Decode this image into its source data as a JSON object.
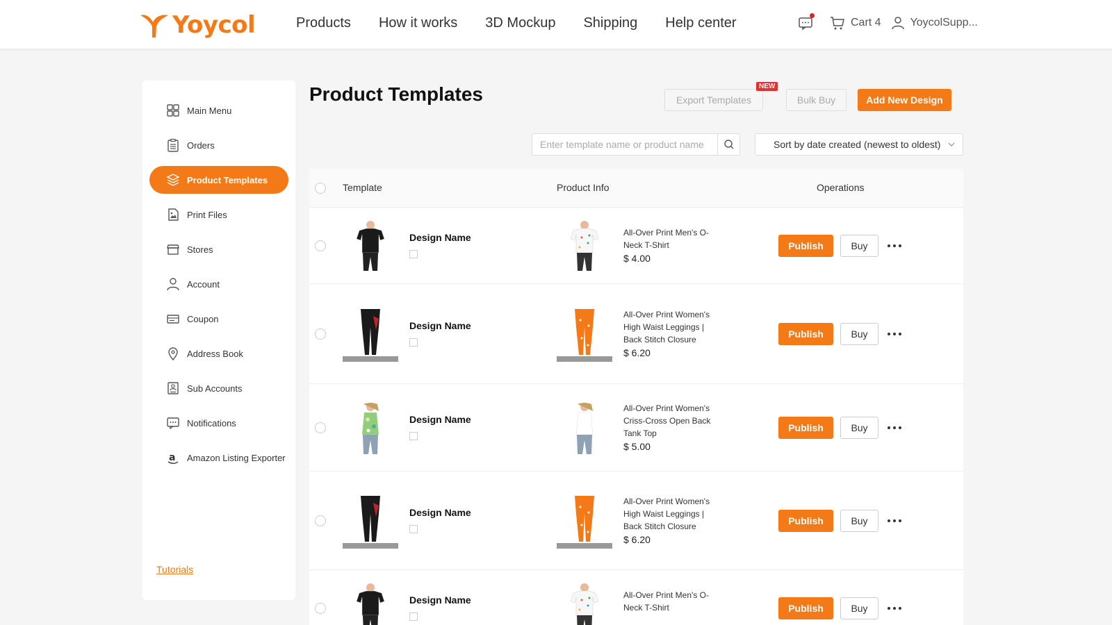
{
  "brand": {
    "name": "Yoycol",
    "color": "#f47a17"
  },
  "nav": [
    "Products",
    "How it works",
    "3D Mockup",
    "Shipping",
    "Help center"
  ],
  "header_right": {
    "cart_label": "Cart 4",
    "user_label": "YoycolSupp..."
  },
  "sidebar": {
    "items": [
      {
        "label": "Main Menu",
        "icon": "grid-icon"
      },
      {
        "label": "Orders",
        "icon": "clipboard-icon"
      },
      {
        "label": "Product Templates",
        "icon": "layers-icon",
        "active": true
      },
      {
        "label": "Print Files",
        "icon": "image-file-icon"
      },
      {
        "label": "Stores",
        "icon": "store-icon"
      },
      {
        "label": "Account",
        "icon": "user-icon"
      },
      {
        "label": "Coupon",
        "icon": "coupon-icon"
      },
      {
        "label": "Address Book",
        "icon": "location-pin-icon"
      },
      {
        "label": "Sub Accounts",
        "icon": "sub-account-icon"
      },
      {
        "label": "Notifications",
        "icon": "message-icon"
      },
      {
        "label": "Amazon Listing Exporter",
        "icon": "amazon-icon"
      }
    ],
    "tutorials_label": "Tutorials"
  },
  "main": {
    "title": "Product Templates",
    "export_label": "Export Templates",
    "new_badge": "NEW",
    "bulk_buy_label": "Bulk Buy",
    "add_design_label": "Add New Design",
    "search_placeholder": "Enter template name or product name",
    "sort_label": "Sort by date created (newest to oldest)"
  },
  "table": {
    "headers": {
      "template": "Template",
      "product_info": "Product Info",
      "operations": "Operations"
    },
    "publish_label": "Publish",
    "buy_label": "Buy",
    "rows": [
      {
        "design_name": "Design Name",
        "product_name": "All-Over Print Men's O-Neck T-Shirt",
        "price": "$ 4.00",
        "product_type": "tshirt"
      },
      {
        "design_name": "Design Name",
        "product_name": "All-Over Print Women's High Waist Leggings | Back Stitch Closure",
        "price": "$ 6.20",
        "product_type": "leggings"
      },
      {
        "design_name": "Design Name",
        "product_name": "All-Over Print Women's Criss-Cross Open Back Tank Top",
        "price": "$ 5.00",
        "product_type": "tank"
      },
      {
        "design_name": "Design Name",
        "product_name": "All-Over Print Women's High Waist Leggings | Back Stitch Closure",
        "price": "$ 6.20",
        "product_type": "leggings"
      },
      {
        "design_name": "Design Name",
        "product_name": "All-Over Print Men's O-Neck T-Shirt",
        "price": "",
        "product_type": "tshirt"
      }
    ]
  }
}
